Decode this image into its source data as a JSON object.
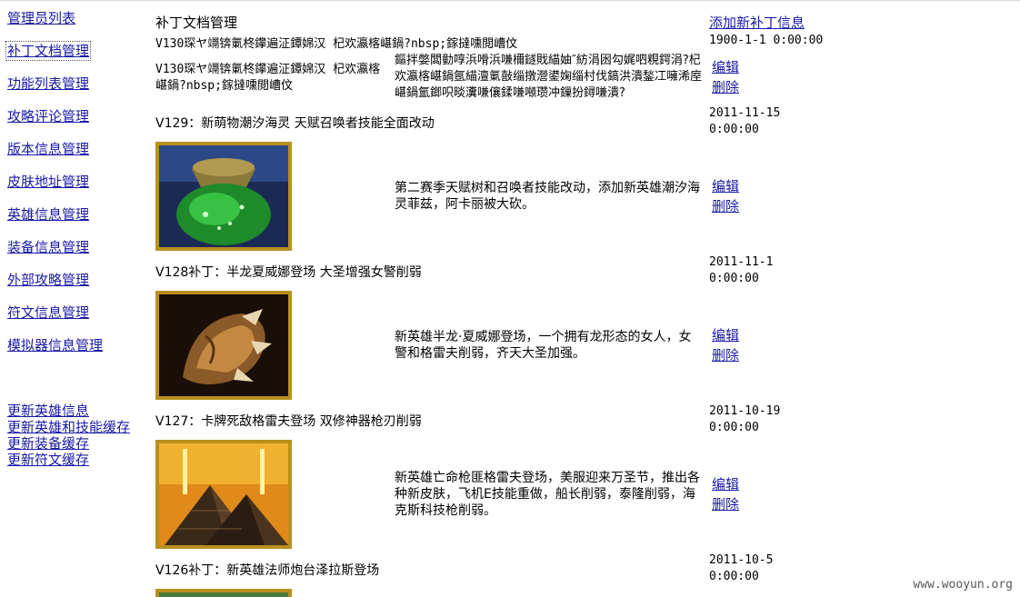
{
  "sidebar": {
    "items": [
      {
        "label": "管理员列表"
      },
      {
        "label": "补丁文档管理"
      },
      {
        "label": "功能列表管理"
      },
      {
        "label": "攻略评论管理"
      },
      {
        "label": "版本信息管理"
      },
      {
        "label": "皮肤地址管理"
      },
      {
        "label": "英雄信息管理"
      },
      {
        "label": "装备信息管理"
      },
      {
        "label": "外部攻略管理"
      },
      {
        "label": "符文信息管理"
      },
      {
        "label": "模拟器信息管理"
      }
    ],
    "cache_links": [
      {
        "label": "更新英雄信息"
      },
      {
        "label": "更新英雄和技能缓存"
      },
      {
        "label": "更新装备缓存"
      },
      {
        "label": "更新符文缓存"
      }
    ]
  },
  "header": {
    "title": "补丁文档管理",
    "add_label": "添加新补丁信息"
  },
  "patches": [
    {
      "title": "V130琛ヤ竵锛氭柊鑻遍泟鐔婂汉 杞欢瀛楁嵁鍋?nbsp;鎵撻嚑閲嶆伩",
      "date": "1900-1-1 0:00:00",
      "left_text": "V130琛ヤ竵锛氭柊鑻遍泟鐔婂汉 杞欢瀛楁嵁鍋?nbsp;鎵撻嚑閲嶆伩",
      "desc": "鏂拌嫳闆勭啍浜嗗浜嗛檷鐩戝緢妯″紡涓囦勾娓呬粯鍔涓?杞欢瀛楁嵁鍋氬緢澶氭敼缁撴瀯鍙婅缁村伐鎬洪潰鍫冮噰浠庢嵁鍋氳鎯呮晱瀵嗛儴鍒嗛噸瓒冲鏁扮鐞嗛潰?",
      "edit_label": "编辑",
      "delete_label": "删除"
    },
    {
      "title": "V129：新萌物潮汐海灵 天赋召唤者技能全面改动",
      "date": "2011-11-15",
      "time": "0:00:00",
      "desc": "第二赛季天赋树和召唤者技能改动，添加新英雄潮汐海灵菲兹，阿卡丽被大砍。",
      "edit_label": "编辑",
      "delete_label": "删除",
      "icon": "green-potion-icon"
    },
    {
      "title": "V128补丁：半龙夏威娜登场 大圣增强女警削弱",
      "date": "2011-11-1",
      "time": "0:00:00",
      "desc": "新英雄半龙·夏威娜登场，一个拥有龙形态的女人，女警和格雷夫削弱，齐天大圣加强。",
      "edit_label": "编辑",
      "delete_label": "删除",
      "icon": "dragon-claw-icon"
    },
    {
      "title": "V127：卡牌死敌格雷夫登场 双修神器枪刃削弱",
      "date": "2011-10-19",
      "time": "0:00:00",
      "desc": "新英雄亡命枪匪格雷夫登场，美服迎来万圣节，推出各种新皮肤，飞机E技能重做，船长削弱，泰隆削弱，海克斯科技枪削弱。",
      "edit_label": "编辑",
      "delete_label": "删除",
      "icon": "pyramid-icon"
    },
    {
      "title": "V126补丁：新英雄法师炮台泽拉斯登场",
      "date": "2011-10-5",
      "time": "0:00:00"
    }
  ],
  "watermark": "www.wooyun.org",
  "colors": {
    "link": "#1a1aa6",
    "background": "#ffffff",
    "thumb_border": "#b8901e"
  }
}
